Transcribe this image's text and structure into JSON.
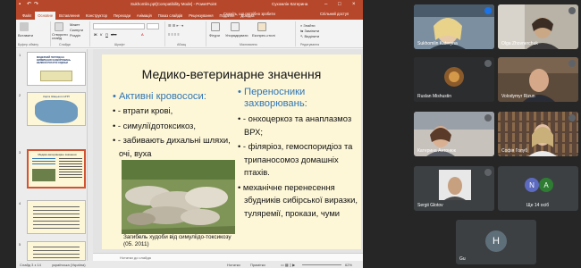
{
  "ppt": {
    "title_bar": "Sukhomlin.ppt[Compatibility Mode] - PowerPoint",
    "user": "Сухомлін Катерина",
    "ribbon_tabs": [
      "Файл",
      "Основне",
      "Вставлення",
      "Конструктор",
      "Переходи",
      "Анімація",
      "Показ слайдів",
      "Рецензування",
      "Подання",
      "Довідка"
    ],
    "active_tab": "Основне",
    "search": "Скажіть, що потрібно зробити",
    "share": "Спільний доступ",
    "ribbon": {
      "paste": "Вставити",
      "layout": "Макет",
      "reset": "Скинути",
      "section": "Розділ",
      "new_slide": "Створити слайд",
      "shapes": "Фігури",
      "arrange": "Упорядкувати",
      "quick_styles": "Експрес-стилі",
      "find": "Знайти",
      "replace": "Замінити",
      "select": "Виділити",
      "group_clipboard": "Буфер обміну",
      "group_slides": "Слайди",
      "group_font": "Шрифт",
      "group_paragraph": "Абзац",
      "group_drawing": "Малювання",
      "group_editing": "Редагування"
    },
    "thumb_numbers": [
      "1",
      "2",
      "3",
      "4",
      "5"
    ],
    "thumbnails": [
      "МОДЕРНИЙ ПОГЛЯД НА ВИЯВЛЕННЯ ЗАХВОРЮВАНЬ ВЕЛИКОЇ РОГАТОЇ ХУДОБИ",
      "Карта Шацького НПП",
      "Медико-ветеринарне значення",
      "",
      ""
    ],
    "slide": {
      "title": "Медико-ветеринарне значення",
      "left_header": "Активні кровососи:",
      "left_items": [
        "- втрати крові,",
        "- симуліїдотоксикоз,",
        "- забивають дихальні шляхи, очі, вуха"
      ],
      "right_header": "Переносники захворювань:",
      "right_items": [
        "- онхоцеркоз та анаплазмоз ВРХ;",
        "- філяріоз, гемоспоридіоз та трипаносомоз домашніх птахів.",
        "механічне перенесення збудників сибірської виразки, туляремії, прокази, чуми"
      ],
      "caption": "Загибель худоби від симуліідо-токсикозу (05. 2011)"
    },
    "notes_placeholder": "Нотатки до слайда",
    "status_left": "Слайд 3 з 14",
    "status_lang": "українська (Україна)",
    "status_notes": "Нотатки",
    "status_comments": "Примітки",
    "zoom": "62%"
  },
  "participants": [
    {
      "name": "Sukhomlin Kateryna"
    },
    {
      "name": "Olga Zhovnerchuk"
    },
    {
      "name": "Ruslan Mishustin"
    },
    {
      "name": "Volodymyr Rizun"
    },
    {
      "name": "Катерина Антонюк"
    },
    {
      "name": "Софія Голуб"
    },
    {
      "name": "Sergii Glotov"
    },
    {
      "name": "Ще 14 осіб",
      "initials": [
        "N",
        "A"
      ]
    },
    {
      "name": "Gu",
      "initial": "H"
    }
  ],
  "colors": {
    "ppt_accent": "#b7472a",
    "slide_bg": "#fdf7d8",
    "header_blue": "#2e75b6"
  }
}
